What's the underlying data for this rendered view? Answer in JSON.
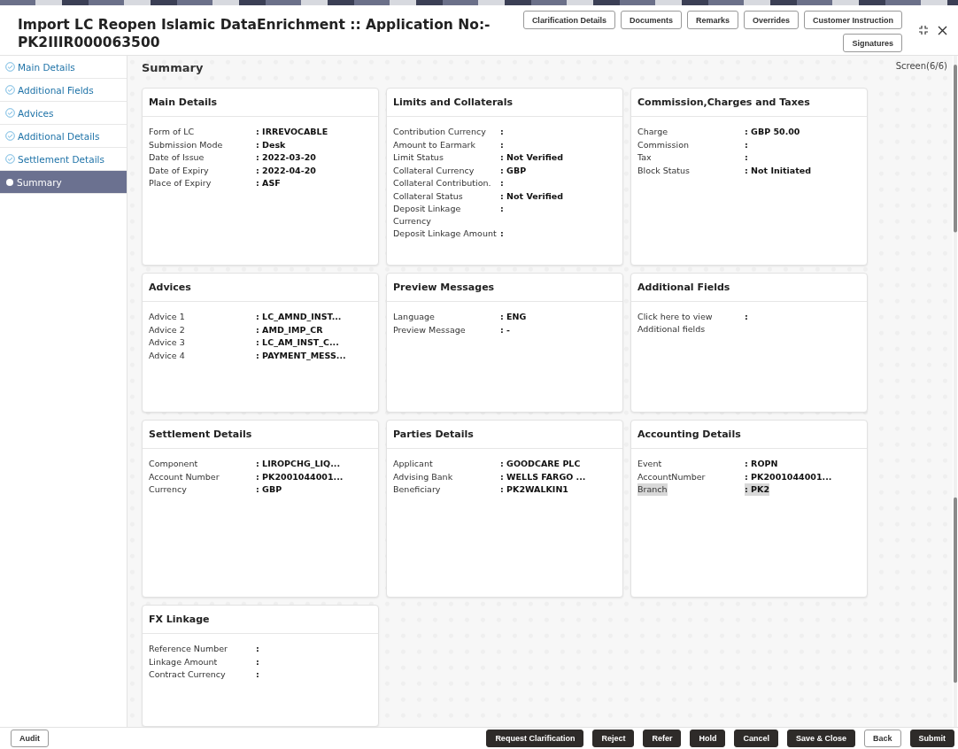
{
  "header": {
    "title": "Import LC Reopen Islamic DataEnrichment :: Application No:- PK2IIIR000063500",
    "buttons": [
      "Clarification Details",
      "Documents",
      "Remarks",
      "Overrides",
      "Customer Instruction"
    ],
    "second_row_buttons": [
      "Signatures"
    ]
  },
  "sidebar": {
    "items": [
      {
        "label": "Main Details",
        "selected": false
      },
      {
        "label": "Additional Fields",
        "selected": false
      },
      {
        "label": "Advices",
        "selected": false
      },
      {
        "label": "Additional Details",
        "selected": false
      },
      {
        "label": "Settlement Details",
        "selected": false
      },
      {
        "label": "Summary",
        "selected": true
      }
    ]
  },
  "content": {
    "title": "Summary",
    "screen_indicator": "Screen(6/6)",
    "cards": [
      {
        "title": "Main Details",
        "fields": [
          {
            "label": "Form of LC",
            "value": ": IRREVOCABLE",
            "highlighted": false
          },
          {
            "label": "Submission Mode",
            "value": ": Desk",
            "highlighted": false
          },
          {
            "label": "Date of Issue",
            "value": ": 2022-03-20",
            "highlighted": false
          },
          {
            "label": "Date of Expiry",
            "value": ": 2022-04-20",
            "highlighted": false
          },
          {
            "label": "Place of Expiry",
            "value": ": ASF",
            "highlighted": false
          }
        ]
      },
      {
        "title": "Limits and Collaterals",
        "fields": [
          {
            "label": "Contribution Currency",
            "value": ":",
            "highlighted": false
          },
          {
            "label": "Amount to Earmark",
            "value": ":",
            "highlighted": false
          },
          {
            "label": "Limit Status",
            "value": ": Not Verified",
            "highlighted": false
          },
          {
            "label": "Collateral Currency",
            "value": ": GBP",
            "highlighted": false
          },
          {
            "label": "Collateral Contribution.",
            "value": ":",
            "highlighted": false
          },
          {
            "label": "Collateral Status",
            "value": ": Not Verified",
            "highlighted": false
          },
          {
            "label": "Deposit Linkage Currency",
            "value": ":",
            "highlighted": false
          },
          {
            "label": "Deposit Linkage Amount",
            "value": ":",
            "highlighted": false
          }
        ]
      },
      {
        "title": "Commission,Charges and Taxes",
        "fields": [
          {
            "label": "Charge",
            "value": ": GBP  50.00",
            "highlighted": false
          },
          {
            "label": "Commission",
            "value": ":",
            "highlighted": false
          },
          {
            "label": "Tax",
            "value": ":",
            "highlighted": false
          },
          {
            "label": "Block Status",
            "value": ": Not Initiated",
            "highlighted": false
          }
        ]
      },
      {
        "title": "Advices",
        "fields": [
          {
            "label": "Advice 1",
            "value": ": LC_AMND_INST...",
            "highlighted": false
          },
          {
            "label": "Advice 2",
            "value": ": AMD_IMP_CR",
            "highlighted": false
          },
          {
            "label": "Advice 3",
            "value": ": LC_AM_INST_C...",
            "highlighted": false
          },
          {
            "label": "Advice 4",
            "value": ": PAYMENT_MESS...",
            "highlighted": false
          }
        ]
      },
      {
        "title": "Preview Messages",
        "fields": [
          {
            "label": "Language",
            "value": ": ENG",
            "highlighted": false
          },
          {
            "label": "Preview Message",
            "value": ": -",
            "highlighted": false
          }
        ]
      },
      {
        "title": "Additional Fields",
        "fields": [
          {
            "label": "Click here to view Additional fields",
            "value": ":",
            "highlighted": false
          }
        ]
      },
      {
        "title": "Settlement Details",
        "fields": [
          {
            "label": "Component",
            "value": ": LIROPCHG_LIQ...",
            "highlighted": false
          },
          {
            "label": "Account Number",
            "value": ": PK2001044001...",
            "highlighted": false
          },
          {
            "label": "Currency",
            "value": ": GBP",
            "highlighted": false
          }
        ]
      },
      {
        "title": "Parties Details",
        "fields": [
          {
            "label": "Applicant",
            "value": ": GOODCARE PLC",
            "highlighted": false
          },
          {
            "label": "Advising Bank",
            "value": ": WELLS FARGO ...",
            "highlighted": false
          },
          {
            "label": "Beneficiary",
            "value": ": PK2WALKIN1",
            "highlighted": false
          }
        ]
      },
      {
        "title": "Accounting Details",
        "fields": [
          {
            "label": "Event",
            "value": ": ROPN",
            "highlighted": false
          },
          {
            "label": "AccountNumber",
            "value": ": PK2001044001...",
            "highlighted": false
          },
          {
            "label": "Branch",
            "value": ": PK2",
            "highlighted": true
          }
        ]
      },
      {
        "title": "FX Linkage",
        "fields": [
          {
            "label": "Reference Number",
            "value": ":",
            "highlighted": false
          },
          {
            "label": "Linkage Amount",
            "value": ":",
            "highlighted": false
          },
          {
            "label": "Contract Currency",
            "value": ":",
            "highlighted": false
          }
        ]
      }
    ]
  },
  "footer": {
    "left_buttons": [
      {
        "label": "Audit",
        "kind": "outline"
      }
    ],
    "right_buttons": [
      {
        "label": "Request Clarification",
        "kind": "dark"
      },
      {
        "label": "Reject",
        "kind": "dark"
      },
      {
        "label": "Refer",
        "kind": "dark"
      },
      {
        "label": "Hold",
        "kind": "dark"
      },
      {
        "label": "Cancel",
        "kind": "dark"
      },
      {
        "label": "Save & Close",
        "kind": "dark"
      },
      {
        "label": "Back",
        "kind": "outline"
      },
      {
        "label": "Submit",
        "kind": "dark"
      }
    ]
  }
}
